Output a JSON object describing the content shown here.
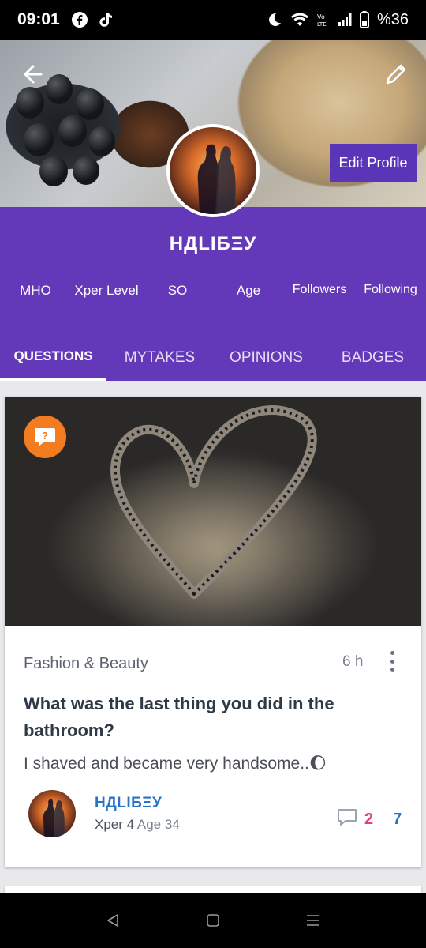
{
  "statusbar": {
    "time": "09:01",
    "battery": "%36",
    "icons": [
      "facebook-icon",
      "tiktok-icon",
      "moon-icon",
      "wifi-icon",
      "volte-icon",
      "signal-icon",
      "battery-icon"
    ]
  },
  "profile": {
    "edit_label": "Edit Profile",
    "username": "НДLIБΞУ"
  },
  "stats": [
    "MHO",
    "Xper Level",
    "SO",
    "Age",
    "Followers",
    "Following"
  ],
  "tabs": [
    "QUESTIONS",
    "MYTAKES",
    "OPINIONS",
    "BADGES"
  ],
  "post": {
    "category": "Fashion & Beauty",
    "time": "6 h",
    "title": "What was the last thing you did in the bathroom?",
    "body": "I shaved and became very handsome..🌔",
    "author": {
      "name": "НДLIБΞУ",
      "xper": "Xper 4",
      "age": "Age 34"
    },
    "comments": "2",
    "votes": "7"
  },
  "colors": {
    "brand_purple": "#6338b9",
    "edit_button": "#5a35b8",
    "question_badge": "#f47c20",
    "link_blue": "#2a72c6",
    "comment_pink": "#e0417a"
  }
}
